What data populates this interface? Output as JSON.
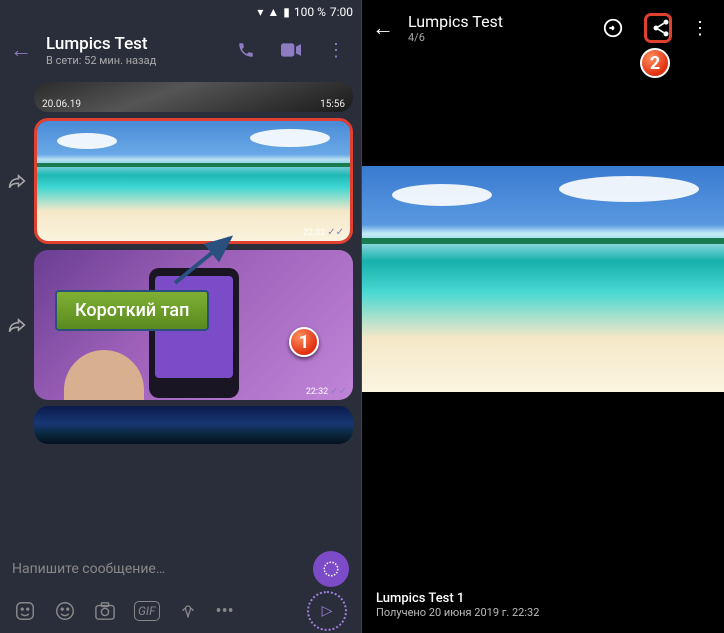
{
  "status": {
    "battery": "100 %",
    "time": "7:00"
  },
  "chat": {
    "title": "Lumpics Test",
    "subtitle": "В сети: 52 мин. назад",
    "date_chip": "20.06.19",
    "date_chip_time": "15:56",
    "msg_time": "22:32",
    "input_placeholder": "Напишите сообщение…"
  },
  "annotation": {
    "label": "Короткий тап",
    "step1": "1",
    "step2": "2"
  },
  "viewer": {
    "title": "Lumpics Test",
    "counter": "4/6",
    "footer_title": "Lumpics Test 1",
    "footer_sub": "Получено 20 июня 2019 г. 22:32"
  },
  "icons": {
    "back": "←",
    "call": "phone",
    "video": "video",
    "overflow": "⋮",
    "forward_msg": "↪",
    "send": "▷",
    "expand": "⊖",
    "share": "share"
  }
}
